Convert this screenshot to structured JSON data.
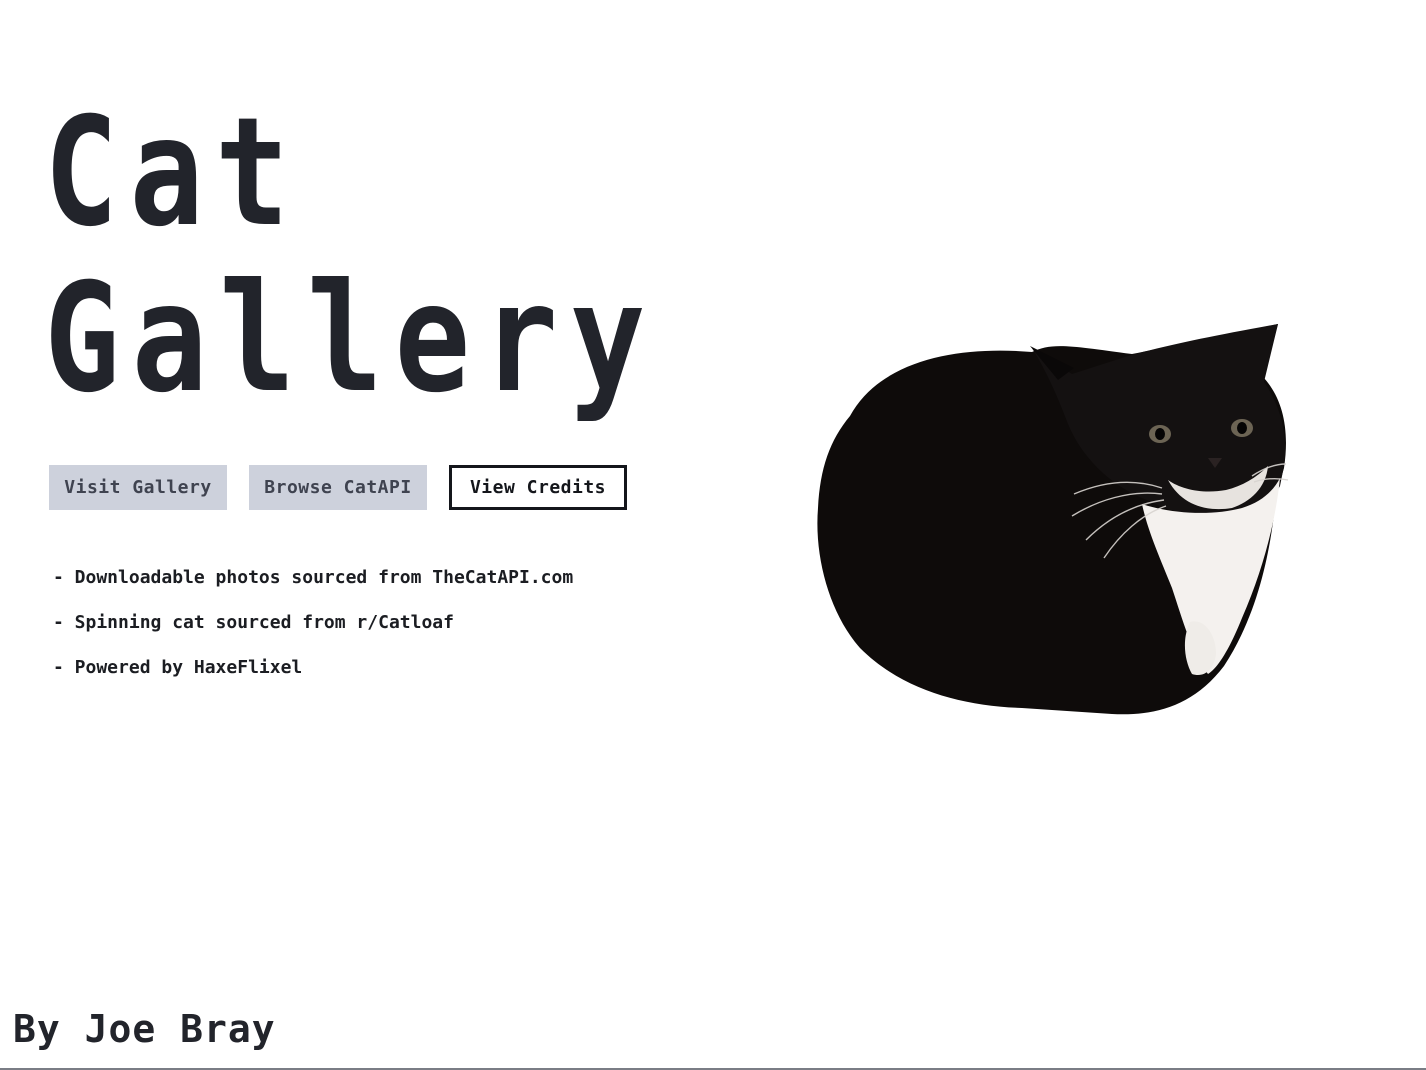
{
  "title": {
    "line1": "Cat",
    "line2": "Gallery"
  },
  "buttons": {
    "visit_gallery": "Visit Gallery",
    "browse_catapi": "Browse CatAPI",
    "view_credits": "View Credits"
  },
  "info": [
    "- Downloadable photos sourced from TheCatAPI.com",
    "- Spinning cat sourced from r/Catloaf",
    "- Powered by HaxeFlixel"
  ],
  "author": "By Joe Bray",
  "colors": {
    "title_text": "#22242b",
    "muted_button_bg": "#cdd1dc",
    "outlined_button_border": "#14161b",
    "background": "#ffffff"
  },
  "icons": {
    "hero_image": "spinning-cat-image"
  }
}
